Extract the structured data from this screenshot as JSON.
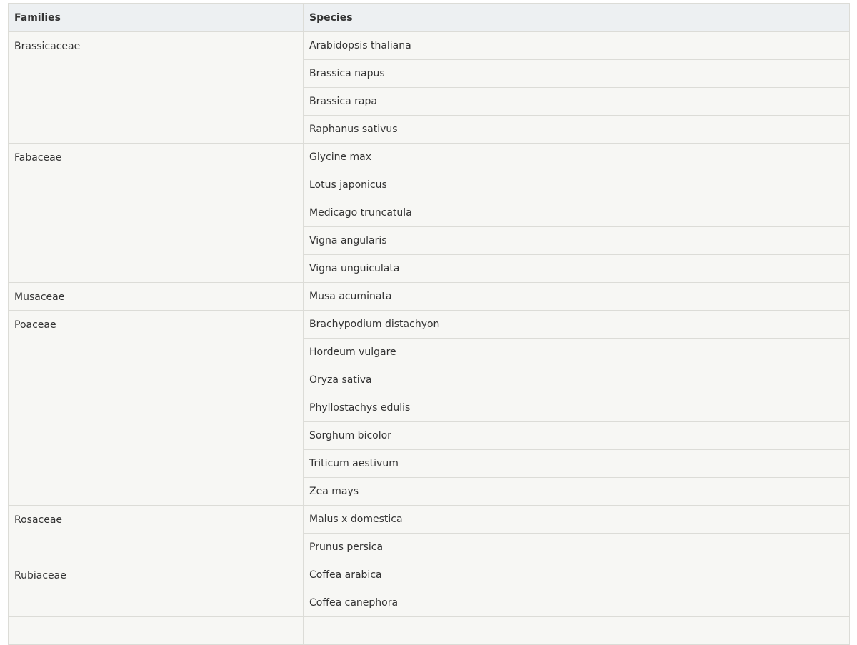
{
  "table": {
    "headers": [
      "Families",
      "Species"
    ],
    "groups": [
      {
        "family": "Brassicaceae",
        "species": [
          "Arabidopsis thaliana",
          "Brassica napus",
          "Brassica rapa",
          "Raphanus sativus"
        ]
      },
      {
        "family": "Fabaceae",
        "species": [
          "Glycine max",
          "Lotus japonicus",
          "Medicago truncatula",
          "Vigna angularis",
          "Vigna unguiculata"
        ]
      },
      {
        "family": "Musaceae",
        "species": [
          "Musa acuminata"
        ]
      },
      {
        "family": "Poaceae",
        "species": [
          "Brachypodium distachyon",
          "Hordeum vulgare",
          "Oryza sativa",
          "Phyllostachys edulis",
          "Sorghum bicolor",
          "Triticum aestivum",
          "Zea mays"
        ]
      },
      {
        "family": "Rosaceae",
        "species": [
          "Malus x domestica",
          "Prunus persica"
        ]
      },
      {
        "family": "Rubiaceae",
        "species": [
          "Coffea arabica",
          "Coffea canephora"
        ]
      }
    ]
  }
}
